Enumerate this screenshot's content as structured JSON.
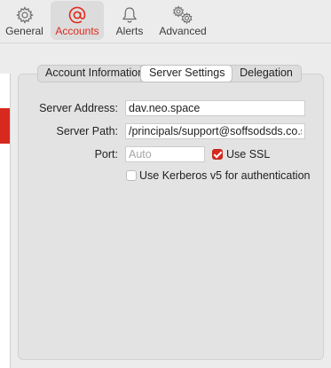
{
  "toolbar": {
    "items": [
      {
        "label": "General",
        "icon": "gear-icon",
        "selected": false
      },
      {
        "label": "Accounts",
        "icon": "at-sign-icon",
        "selected": true
      },
      {
        "label": "Alerts",
        "icon": "bell-icon",
        "selected": false
      },
      {
        "label": "Advanced",
        "icon": "gears-icon",
        "selected": false
      }
    ]
  },
  "tabs": {
    "account_information": "Account Information",
    "server_settings": "Server Settings",
    "delegation": "Delegation",
    "active": "Server Settings"
  },
  "server_settings": {
    "server_address_label": "Server Address:",
    "server_address_value": "dav.neo.space",
    "server_path_label": "Server Path:",
    "server_path_value": "/principals/support@soffsodsds.co.sit",
    "port_label": "Port:",
    "port_value": "",
    "port_placeholder": "Auto",
    "use_ssl_label": "Use SSL",
    "use_ssl_checked": true,
    "kerberos_label": "Use Kerberos v5 for authentication",
    "kerberos_checked": false
  },
  "colors": {
    "accent": "#e0291d",
    "window_bg": "#ececec",
    "panel_bg": "#e3e3e3"
  }
}
